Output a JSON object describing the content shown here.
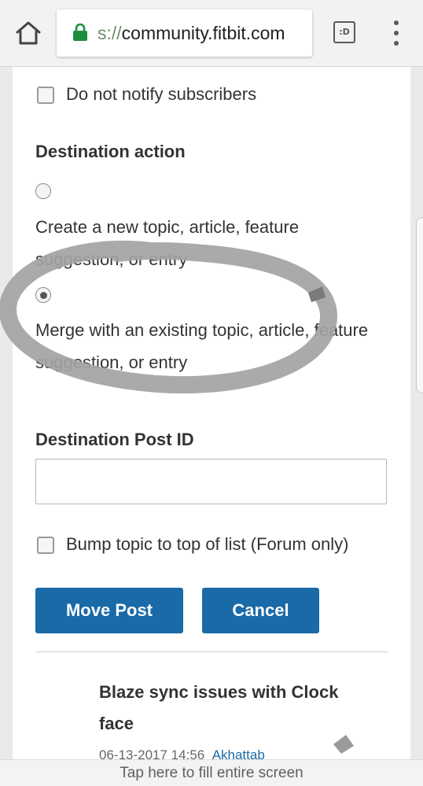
{
  "browser": {
    "url_faded_prefix": "s://",
    "url_domain": "community.fitbit.com",
    "tab_switcher_label": ":D"
  },
  "form": {
    "notify_checkbox_label": "Do not notify subscribers",
    "destination_action_heading": "Destination action",
    "option_new_text": "Create a new topic, article, feature suggestion, or entry",
    "option_merge_text": "Merge with an existing topic, article, feature suggestion, or entry",
    "selected_option": "merge",
    "destination_post_id_label": "Destination Post ID",
    "destination_post_id_value": "",
    "bump_checkbox_label": "Bump topic to top of list (Forum only)",
    "move_button_label": "Move Post",
    "cancel_button_label": "Cancel"
  },
  "post_preview": {
    "title": "Blaze sync issues with Clock face",
    "timestamp": "06-13-2017 14:56",
    "author": "Akhattab"
  },
  "banner": {
    "text": "Tap here to fill entire screen"
  },
  "colors": {
    "primary_button": "#1a6aa8",
    "lock_green": "#1e8e3e",
    "annotation_stroke": "#9e9e9e"
  },
  "icons": {
    "home": "home-icon",
    "lock": "lock-icon",
    "tabs": "tab-switcher-icon",
    "menu": "more-vert-icon"
  }
}
